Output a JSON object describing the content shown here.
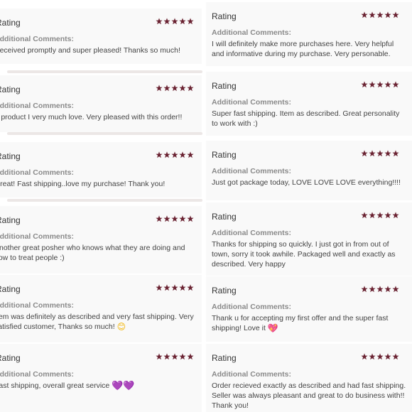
{
  "colors": {
    "star": "#6b2433",
    "label": "#8a8a8a",
    "text": "#444444",
    "card_bg": "#f9f9f9"
  },
  "reviews": [
    {
      "rating_title": "Rating",
      "label": "Additional Comments:",
      "comment": "Received promptly and super pleased! Thanks so much!",
      "stars": 5
    },
    {
      "rating_title": "Rating",
      "label": "Additional Comments:",
      "comment": "A product I very much love. Very pleased with this order!!",
      "stars": 5
    },
    {
      "rating_title": "Rating",
      "label": "Additional Comments:",
      "comment": "Great! Fast shipping..love my purchase! Thank you!",
      "stars": 5
    },
    {
      "rating_title": "Rating",
      "label": "Additional Comments:",
      "comment": "Another great posher who knows what they are doing and how to treat people :)",
      "stars": 5
    },
    {
      "rating_title": "Rating",
      "label": "Additional Comments:",
      "comment": "Item was definitely as described and very fast shipping. Very satisfied customer, Thanks so much!",
      "emoji": "😊",
      "stars": 5
    },
    {
      "rating_title": "Rating",
      "label": "Additional Comments:",
      "comment": "Fast shipping, overall great service",
      "emoji": "💜💜",
      "stars": 5
    },
    {
      "rating_title": "Rating",
      "label": "Additional Comments:",
      "comment": "I will definitely make more purchases here. Very helpful and informative during my purchase. Very personable.",
      "stars": 5
    },
    {
      "rating_title": "Rating",
      "label": "Additional Comments:",
      "comment": "Super fast shipping. Item as described. Great personality to work with :)",
      "stars": 5
    },
    {
      "rating_title": "Rating",
      "label": "Additional Comments:",
      "comment": "Just got package today, LOVE LOVE LOVE everything!!!!",
      "stars": 5
    },
    {
      "rating_title": "Rating",
      "label": "Additional Comments:",
      "comment": "Thanks for shipping so quickly. I just got in from out of town, sorry it took awhile. Packaged well and exactly as described. Very happy",
      "stars": 5
    },
    {
      "rating_title": "Rating",
      "label": "Additional Comments:",
      "comment": "Thank u for accepting my first offer and the super fast shipping! Love it",
      "emoji": "💖",
      "stars": 5
    },
    {
      "rating_title": "Rating",
      "label": "Additional Comments:",
      "comment": "Order recieved exactly as described and had fast shipping. Seller was always pleasant and great to do business with!! Thank you!",
      "stars": 5
    }
  ]
}
